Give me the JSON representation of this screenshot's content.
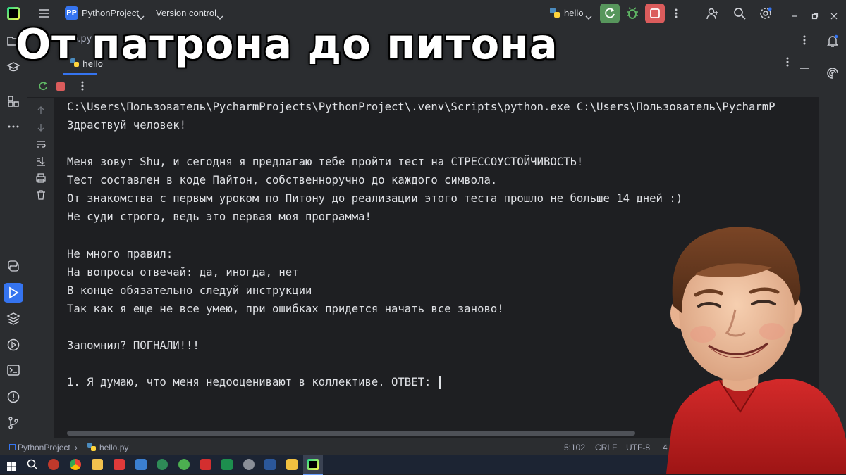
{
  "window": {
    "project_badge": "PP",
    "project_name": "PythonProject",
    "version_control": "Version control",
    "run_config": "hello"
  },
  "tabs": {
    "editor_tab": "hello.py",
    "run_tab": "hello"
  },
  "overlay": {
    "title": "От патрона  до  питона"
  },
  "console": {
    "lines": [
      "C:\\Users\\Пользователь\\PycharmProjects\\PythonProject\\.venv\\Scripts\\python.exe C:\\Users\\Пользователь\\PycharmP",
      "Здраствуй человек!",
      "",
      "Меня зовут Shu, и сегодня я предлагаю тебе пройти тест на СТРЕССОУСТОЙЧИВОСТЬ!",
      "Тест составлен в коде Пайтон, собственноручно до каждого символа.",
      "От знакомства с первым уроком по Питону до реализации этого теста прошло не больше 14 дней :)",
      "Не суди строго, ведь это первая моя программа!",
      "",
      "Не много правил:",
      "На вопросы отвечай: да, иногда, нет",
      "В конце обязательно следуй инструкции",
      "Так как я еще не все умею, при ошибках придется начать все заново!",
      "",
      "Запомнил? ПОГНАЛИ!!!",
      "",
      "1. Я думаю, что меня недооценивают в коллективе. ОТВЕТ: "
    ]
  },
  "statusbar": {
    "breadcrumb_project": "PythonProject",
    "breadcrumb_file": "hello.py",
    "position": "5:102",
    "line_sep": "CRLF",
    "encoding": "UTF-8",
    "indent": "4"
  },
  "colors": {
    "accent": "#3574f0",
    "run_green": "#57965c",
    "stop_red": "#db5c5c"
  }
}
